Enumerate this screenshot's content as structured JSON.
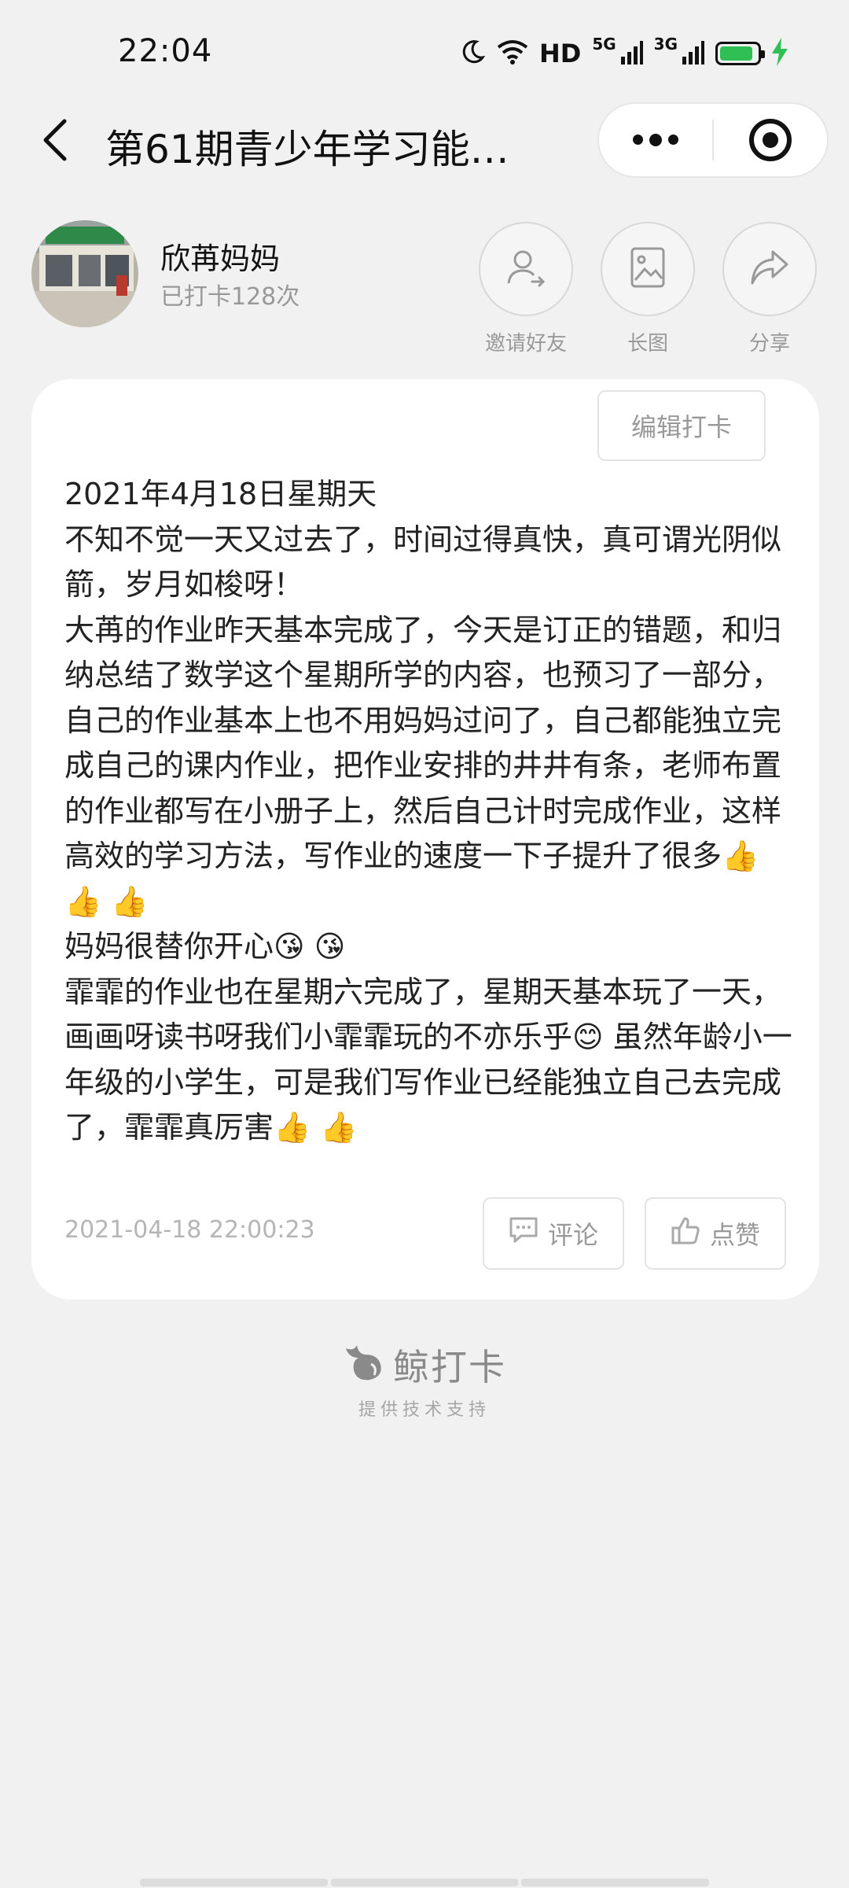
{
  "status_bar": {
    "time": "22:04",
    "network_label": "HD",
    "signal_1": "5G",
    "signal_2": "3G",
    "battery_level": 0.9,
    "battery_color": "#2fbf55"
  },
  "nav": {
    "title": "第61期青少年学习能…",
    "icons": [
      "back-arrow-icon",
      "more-dots-icon",
      "target-icon"
    ]
  },
  "user": {
    "name": "欣苒妈妈",
    "checkin_count": "已打卡128次",
    "actions": [
      {
        "label": "邀请好友",
        "icon": "invite-user-icon"
      },
      {
        "label": "长图",
        "icon": "long-image-icon"
      },
      {
        "label": "分享",
        "icon": "share-arrow-icon"
      }
    ]
  },
  "post": {
    "edit_label": "编辑打卡",
    "lines": [
      "2021年4月18日星期天",
      "不知不觉一天又过去了，时间过得真快，真可谓光阴似箭，岁月如梭呀！",
      "大苒的作业昨天基本完成了，今天是订正的错题，和归纳总结了数学这个星期所学的内容，也预习了一部分，自己的作业基本上也不用妈妈过问了，自己都能独立完成自己的课内作业，把作业安排的井井有条，老师布置的作业都写在小册子上，然后自己计时完成作业，这样高效的学习方法，写作业的速度一下子提升了很多👍 👍 👍",
      "妈妈很替你开心😘 😘",
      "霏霏的作业也在星期六完成了，星期天基本玩了一天，画画呀读书呀我们小霏霏玩的不亦乐乎😊 虽然年龄小一年级的小学生，可是我们写作业已经能独立自己去完成了，霏霏真厉害👍 👍"
    ],
    "timestamp": "2021-04-18 22:00:23",
    "comment_label": "评论",
    "like_label": "点赞"
  },
  "footer": {
    "brand_name": "鲸打卡",
    "brand_sub": "提供技术支持"
  },
  "colors": {
    "background": "#f1f1f1",
    "card": "#ffffff",
    "muted_text": "#999999"
  }
}
